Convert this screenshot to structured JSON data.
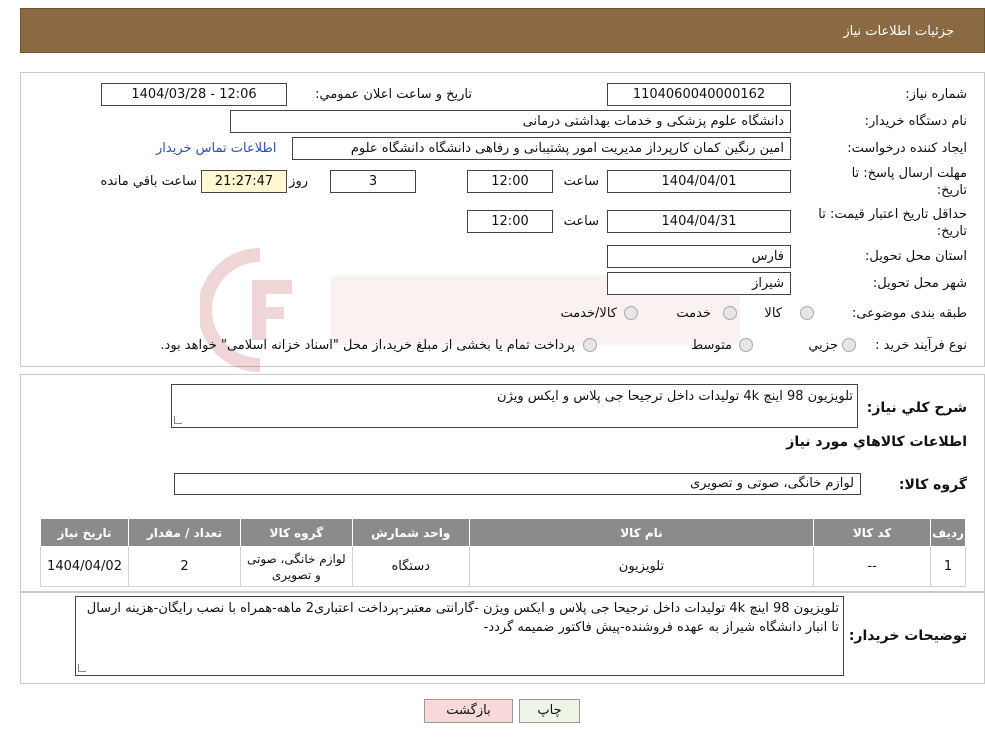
{
  "header": {
    "title": "جزئیات اطلاعات نیاز"
  },
  "fields": {
    "need_number_label": "شماره نیاز:",
    "need_number": "1104060040000162",
    "announce_label": "تاريخ و ساعت اعلان عمومي:",
    "announce_value": "1404/03/28 - 12:06",
    "buyer_org_label": "نام دستگاه خريدار:",
    "buyer_org": "دانشگاه علوم پزشکی و خدمات بهداشتی درمانی",
    "creator_label": "ايجاد کننده درخواست:",
    "creator": "امین رنگین کمان کارپرداز مدیریت امور پشتیبانی و رفاهی دانشگاه دانشگاه علوم",
    "contact_link": "اطلاعات تماس خريدار",
    "deadline_label_1": "مهلت ارسال پاسخ: تا",
    "deadline_label_2": "تاريخ:",
    "deadline_date": "1404/04/01",
    "time_label": "ساعت",
    "deadline_time": "12:00",
    "days_value": "3",
    "days_label": "روز و",
    "remaining_time": "21:27:47",
    "remaining_label": "ساعت باقي مانده",
    "validity_label_1": "حداقل تاريخ اعتبار قيمت: تا",
    "validity_label_2": "تاريخ:",
    "validity_date": "1404/04/31",
    "validity_time": "12:00",
    "province_label": "استان محل تحويل:",
    "province": "فارس",
    "city_label": "شهر محل تحويل:",
    "city": "شیراز",
    "category_label": "طبقه بندی موضوعی:",
    "category_options": [
      "کالا",
      "خدمت",
      "کالا/خدمت"
    ],
    "process_label": "نوع فرآيند خريد :",
    "process_options": [
      "جزيي",
      "متوسط"
    ],
    "process_note": "پرداخت تمام یا بخشی از مبلغ خرید،از محل \"اسناد خزانه اسلامی\" خواهد بود."
  },
  "summary": {
    "label": "شرح کلي نياز:",
    "value": "تلویزیون 98 اینچ  4k تولیدات داخل ترجیحا جی پلاس و ایکس ویژن",
    "goods_info_title": "اطلاعات کالاهاي مورد نياز",
    "group_label": "گروه کالا:",
    "group_value": "لوازم خانگی، صوتی و تصویری"
  },
  "table": {
    "headers": [
      "رديف",
      "کد کالا",
      "نام کالا",
      "واحد شمارش",
      "گروه کالا",
      "تعداد / مقدار",
      "تاريخ نياز"
    ],
    "rows": [
      [
        "1",
        "--",
        "تلویزیون",
        "دستگاه",
        "لوازم خانگی، صوتی و تصویری",
        "2",
        "1404/04/02"
      ]
    ]
  },
  "buyer_notes": {
    "label": "توضيحات خريدار:",
    "value": "تلویزیون 98 اینچ  4k تولیدات داخل ترجیحا جی پلاس و ایکس ویژن  -گارانتی معتبر-پرداخت اعتباری2 ماهه-همراه با نصب رایگان-هزینه ارسال تا انبار دانشگاه شیراز به عهده فروشنده-پیش فاکتور ضمیمه گردد-"
  },
  "buttons": {
    "print": "چاپ",
    "back": "بازگشت"
  },
  "colors": {
    "header": "#8b6a43",
    "table_header": "#8b8b8b",
    "back_button": "#f7d9d9",
    "print_button": "#eef5e6",
    "highlight": "#fff8d2",
    "link": "#2a50b8"
  }
}
